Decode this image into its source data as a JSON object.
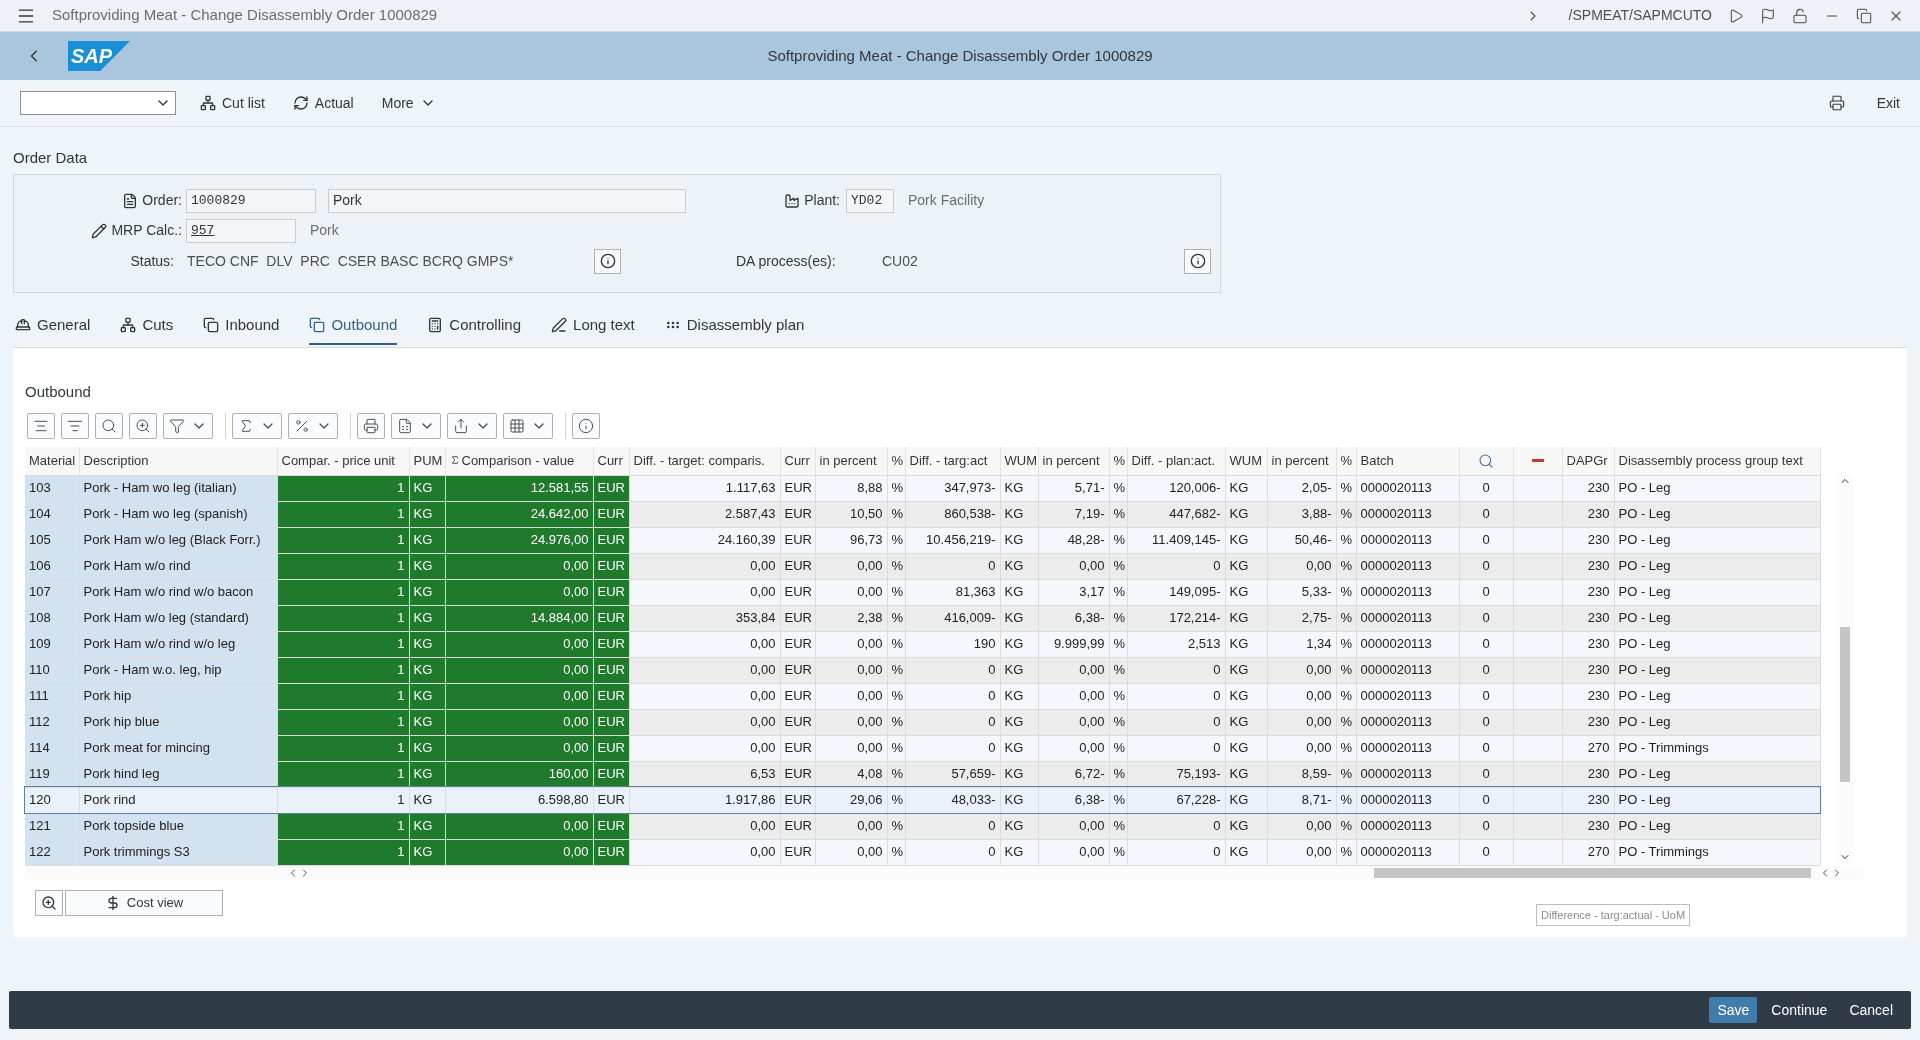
{
  "shell": {
    "title": "Softproviding Meat - Change Disassembly Order 1000829",
    "transaction": "/SPMEAT/SAPMCUTO"
  },
  "header": {
    "logo": "SAP",
    "title": "Softproviding Meat - Change Disassembly Order 1000829"
  },
  "toolbar": {
    "buttons": [
      {
        "label": "Cut list",
        "kind": "cutlist"
      },
      {
        "label": "Actual",
        "kind": "refresh"
      },
      {
        "label": "More",
        "kind": "menu"
      }
    ],
    "exit": "Exit"
  },
  "order_data": {
    "title": "Order Data",
    "order": {
      "label": "Order:",
      "value": "1000829",
      "description": "Pork"
    },
    "plant": {
      "label": "Plant:",
      "value": "YD02",
      "description": "Pork Facility"
    },
    "mrp": {
      "label": "MRP Calc.:",
      "value": "957",
      "description": "Pork"
    },
    "status": {
      "label": "Status:",
      "value": "TECO CNF  DLV  PRC  CSER BASC BCRQ GMPS*"
    },
    "da": {
      "label": "DA process(es):",
      "value": "CU02"
    }
  },
  "tabs": [
    {
      "label": "General",
      "selected": false
    },
    {
      "label": "Cuts",
      "selected": false
    },
    {
      "label": "Inbound",
      "selected": false
    },
    {
      "label": "Outbound",
      "selected": true
    },
    {
      "label": "Controlling",
      "selected": false
    },
    {
      "label": "Long text",
      "selected": false
    },
    {
      "label": "Disassembly plan",
      "selected": false
    }
  ],
  "outbound": {
    "title": "Outbound",
    "columns": [
      {
        "kind": "text",
        "label": "Material"
      },
      {
        "kind": "text",
        "label": "Description"
      },
      {
        "kind": "text",
        "label": "Compar. - price unit"
      },
      {
        "kind": "text",
        "label": "PUM"
      },
      {
        "kind": "sum",
        "label": "Comparison - value"
      },
      {
        "kind": "text",
        "label": "Curr"
      },
      {
        "kind": "text",
        "label": "Diff. - target: comparis."
      },
      {
        "kind": "text",
        "label": "Curr"
      },
      {
        "kind": "text",
        "label": "in percent"
      },
      {
        "kind": "text",
        "label": "%"
      },
      {
        "kind": "text",
        "label": "Diff. - targ:act"
      },
      {
        "kind": "text",
        "label": "WUM"
      },
      {
        "kind": "text",
        "label": "in percent"
      },
      {
        "kind": "text",
        "label": "%"
      },
      {
        "kind": "text",
        "label": "Diff. - plan:act."
      },
      {
        "kind": "text",
        "label": "WUM"
      },
      {
        "kind": "text",
        "label": "in percent"
      },
      {
        "kind": "text",
        "label": "%"
      },
      {
        "kind": "text",
        "label": "Batch"
      },
      {
        "kind": "lens"
      },
      {
        "kind": "dash"
      },
      {
        "kind": "text",
        "label": "DAPGr"
      },
      {
        "kind": "text",
        "label": "Disassembly process group text"
      }
    ],
    "rows": [
      {
        "selected": false,
        "cells": [
          "103",
          "Pork - Ham wo leg (italian)",
          "1",
          "KG",
          "12.581,55",
          "EUR",
          "1.117,63",
          "EUR",
          "8,88",
          "%",
          "347,973-",
          "KG",
          "5,71-",
          "%",
          "120,006-",
          "KG",
          "2,05-",
          "%",
          "0000020113",
          "0",
          "",
          "230",
          "PO - Leg"
        ]
      },
      {
        "selected": false,
        "cells": [
          "104",
          "Pork - Ham wo leg (spanish)",
          "1",
          "KG",
          "24.642,00",
          "EUR",
          "2.587,43",
          "EUR",
          "10,50",
          "%",
          "860,538-",
          "KG",
          "7,19-",
          "%",
          "447,682-",
          "KG",
          "3,88-",
          "%",
          "0000020113",
          "0",
          "",
          "230",
          "PO - Leg"
        ]
      },
      {
        "selected": false,
        "cells": [
          "105",
          "Pork Ham w/o leg (Black Forr.)",
          "1",
          "KG",
          "24.976,00",
          "EUR",
          "24.160,39",
          "EUR",
          "96,73",
          "%",
          "10.456,219-",
          "KG",
          "48,28-",
          "%",
          "11.409,145-",
          "KG",
          "50,46-",
          "%",
          "0000020113",
          "0",
          "",
          "230",
          "PO - Leg"
        ]
      },
      {
        "selected": false,
        "cells": [
          "106",
          "Pork Ham w/o rind",
          "1",
          "KG",
          "0,00",
          "EUR",
          "0,00",
          "EUR",
          "0,00",
          "%",
          "0",
          "KG",
          "0,00",
          "%",
          "0",
          "KG",
          "0,00",
          "%",
          "0000020113",
          "0",
          "",
          "230",
          "PO - Leg"
        ]
      },
      {
        "selected": false,
        "cells": [
          "107",
          "Pork Ham w/o rind w/o bacon",
          "1",
          "KG",
          "0,00",
          "EUR",
          "0,00",
          "EUR",
          "0,00",
          "%",
          "81,363",
          "KG",
          "3,17",
          "%",
          "149,095-",
          "KG",
          "5,33-",
          "%",
          "0000020113",
          "0",
          "",
          "230",
          "PO - Leg"
        ]
      },
      {
        "selected": false,
        "cells": [
          "108",
          "Pork Ham w/o leg (standard)",
          "1",
          "KG",
          "14.884,00",
          "EUR",
          "353,84",
          "EUR",
          "2,38",
          "%",
          "416,009-",
          "KG",
          "6,38-",
          "%",
          "172,214-",
          "KG",
          "2,75-",
          "%",
          "0000020113",
          "0",
          "",
          "230",
          "PO - Leg"
        ]
      },
      {
        "selected": false,
        "cells": [
          "109",
          "Pork Ham w/o rind w/o leg",
          "1",
          "KG",
          "0,00",
          "EUR",
          "0,00",
          "EUR",
          "0,00",
          "%",
          "190",
          "KG",
          "9.999,99",
          "%",
          "2,513",
          "KG",
          "1,34",
          "%",
          "0000020113",
          "0",
          "",
          "230",
          "PO - Leg"
        ]
      },
      {
        "selected": false,
        "cells": [
          "110",
          "Pork - Ham w.o. leg, hip",
          "1",
          "KG",
          "0,00",
          "EUR",
          "0,00",
          "EUR",
          "0,00",
          "%",
          "0",
          "KG",
          "0,00",
          "%",
          "0",
          "KG",
          "0,00",
          "%",
          "0000020113",
          "0",
          "",
          "230",
          "PO - Leg"
        ]
      },
      {
        "selected": false,
        "cells": [
          "111",
          "Pork hip",
          "1",
          "KG",
          "0,00",
          "EUR",
          "0,00",
          "EUR",
          "0,00",
          "%",
          "0",
          "KG",
          "0,00",
          "%",
          "0",
          "KG",
          "0,00",
          "%",
          "0000020113",
          "0",
          "",
          "230",
          "PO - Leg"
        ]
      },
      {
        "selected": false,
        "cells": [
          "112",
          "Pork hip blue",
          "1",
          "KG",
          "0,00",
          "EUR",
          "0,00",
          "EUR",
          "0,00",
          "%",
          "0",
          "KG",
          "0,00",
          "%",
          "0",
          "KG",
          "0,00",
          "%",
          "0000020113",
          "0",
          "",
          "230",
          "PO - Leg"
        ]
      },
      {
        "selected": false,
        "cells": [
          "114",
          "Pork meat for mincing",
          "1",
          "KG",
          "0,00",
          "EUR",
          "0,00",
          "EUR",
          "0,00",
          "%",
          "0",
          "KG",
          "0,00",
          "%",
          "0",
          "KG",
          "0,00",
          "%",
          "0000020113",
          "0",
          "",
          "270",
          "PO - Trimmings"
        ]
      },
      {
        "selected": false,
        "cells": [
          "119",
          "Pork hind leg",
          "1",
          "KG",
          "160,00",
          "EUR",
          "6,53",
          "EUR",
          "4,08",
          "%",
          "57,659-",
          "KG",
          "6,72-",
          "%",
          "75,193-",
          "KG",
          "8,59-",
          "%",
          "0000020113",
          "0",
          "",
          "230",
          "PO - Leg"
        ]
      },
      {
        "selected": true,
        "cells": [
          "120",
          "Pork rind",
          "1",
          "KG",
          "6.598,80",
          "EUR",
          "1.917,86",
          "EUR",
          "29,06",
          "%",
          "48,033-",
          "KG",
          "6,38-",
          "%",
          "67,228-",
          "KG",
          "8,71-",
          "%",
          "0000020113",
          "0",
          "",
          "230",
          "PO - Leg"
        ]
      },
      {
        "selected": false,
        "cells": [
          "121",
          "Pork topside blue",
          "1",
          "KG",
          "0,00",
          "EUR",
          "0,00",
          "EUR",
          "0,00",
          "%",
          "0",
          "KG",
          "0,00",
          "%",
          "0",
          "KG",
          "0,00",
          "%",
          "0000020113",
          "0",
          "",
          "230",
          "PO - Leg"
        ]
      },
      {
        "selected": false,
        "cells": [
          "122",
          "Pork trimmings S3",
          "1",
          "KG",
          "0,00",
          "EUR",
          "0,00",
          "EUR",
          "0,00",
          "%",
          "0",
          "KG",
          "0,00",
          "%",
          "0",
          "KG",
          "0,00",
          "%",
          "0000020113",
          "0",
          "",
          "270",
          "PO - Trimmings"
        ]
      }
    ],
    "tooltip": "Difference - targ:actual - UoM",
    "cost_view": "Cost view"
  },
  "footer": {
    "buttons": [
      {
        "label": "Save",
        "kind": "primary"
      },
      {
        "label": "Continue",
        "kind": "plain"
      },
      {
        "label": "Cancel",
        "kind": "plain"
      }
    ]
  }
}
